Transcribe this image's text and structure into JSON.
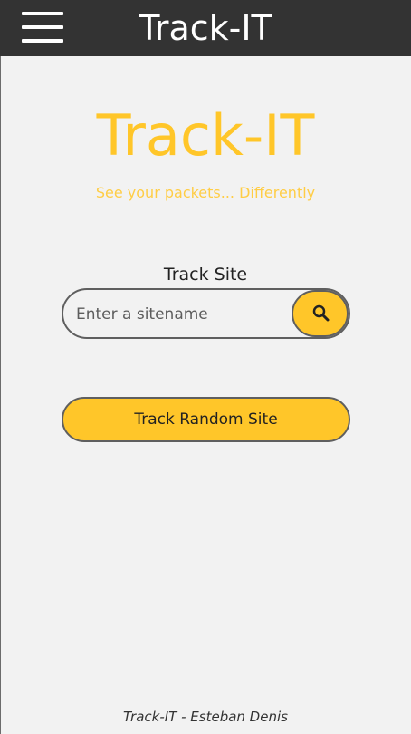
{
  "app": {
    "title": "Track-IT"
  },
  "hero": {
    "title": "Track-IT",
    "tagline": "See your packets... Differently"
  },
  "search": {
    "label": "Track Site",
    "placeholder": "Enter a sitename",
    "value": "",
    "button_icon": "search-icon"
  },
  "actions": {
    "random_label": "Track Random Site"
  },
  "footer": {
    "text": "Track-IT - Esteban Denis"
  },
  "colors": {
    "topbar": "#333333",
    "background": "#f2f2f2",
    "accent": "#ffc629",
    "tagline": "#ffcd45",
    "border": "#5f5f5f"
  }
}
